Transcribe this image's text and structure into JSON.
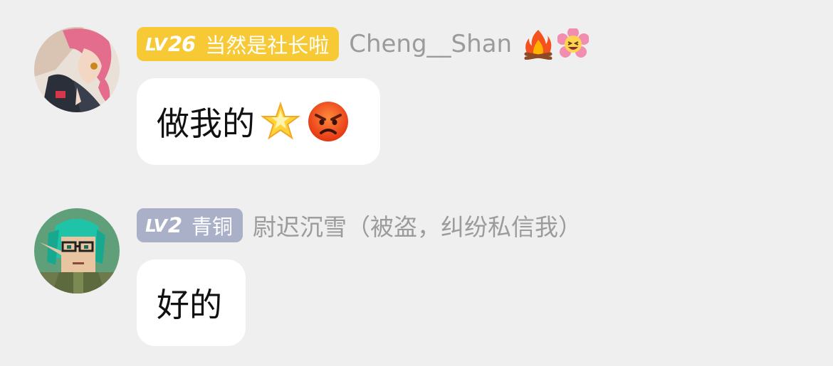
{
  "messages": [
    {
      "badge": {
        "prefix": "LV",
        "level": "26",
        "title": "当然是社长啦",
        "color": "#f7c934"
      },
      "username": "Cheng__Shan",
      "name_icons": [
        "fire-icon",
        "laughing-flower-icon"
      ],
      "text": "做我的",
      "text_icons": [
        "glowing-star-icon",
        "angry-face-icon"
      ]
    },
    {
      "badge": {
        "prefix": "LV",
        "level": "2",
        "title": "青铜",
        "color": "#a9b0c8"
      },
      "username": "尉迟沉雪（被盗，纠纷私信我）",
      "name_icons": [],
      "text": "好的",
      "text_icons": []
    }
  ]
}
